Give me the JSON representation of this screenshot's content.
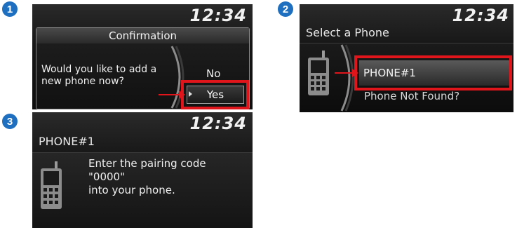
{
  "steps": {
    "one": "1",
    "two": "2",
    "three": "3"
  },
  "screen1": {
    "clock": "12:34",
    "dialog_title": "Confirmation",
    "message_line1": "Would you like to add a",
    "message_line2": "new phone now?",
    "option_no": "No",
    "option_yes": "Yes"
  },
  "screen2": {
    "clock": "12:34",
    "header": "Select a Phone",
    "items": [
      "PHONE#1",
      "Phone Not Found?"
    ]
  },
  "screen3": {
    "clock": "12:34",
    "header": "PHONE#1",
    "line1": "Enter the pairing code",
    "line2": "\"0000\"",
    "line3": "into your phone."
  },
  "colors": {
    "highlight": "#e0141b",
    "step_badge": "#1f6fc0",
    "screen_bg": "#0d0d0d"
  },
  "icons": [
    "phone-icon",
    "arrow-icon"
  ]
}
